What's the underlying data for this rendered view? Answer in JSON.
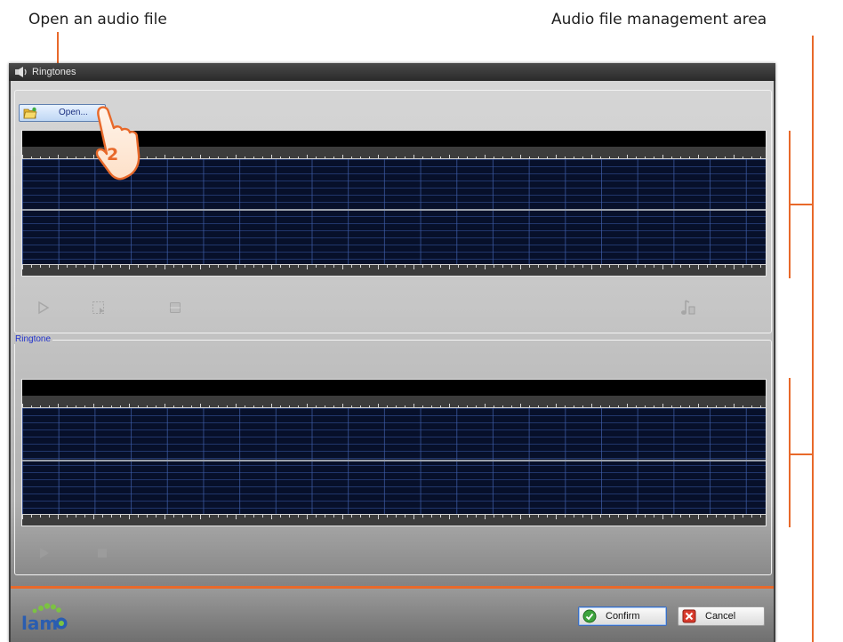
{
  "annotations": {
    "open_label": "Open an audio file",
    "area_label": "Audio file management area"
  },
  "window": {
    "title": "Ringtones",
    "icon": "speaker-icon"
  },
  "audio_panel": {
    "open_button_label": "Open...",
    "open_button_icon": "folder-open-icon",
    "controls": [
      "play-icon",
      "select-icon",
      "stop-icon",
      "music-note-icon"
    ]
  },
  "ringtone_panel": {
    "legend": "Ringtone",
    "controls": [
      "play-icon",
      "stop-icon"
    ]
  },
  "callout": {
    "step_number": "2",
    "icon": "hand-pointer-icon"
  },
  "footer": {
    "logo_text": "lam",
    "confirm_label": "Confirm",
    "confirm_icon": "check-icon",
    "cancel_label": "Cancel",
    "cancel_icon": "x-icon"
  },
  "colors": {
    "accent_orange": "#e8692a",
    "waveform_bg": "#07102a",
    "grid_line": "#405faa",
    "legend_blue": "#2233cc",
    "logo_blue": "#2a5db0"
  }
}
